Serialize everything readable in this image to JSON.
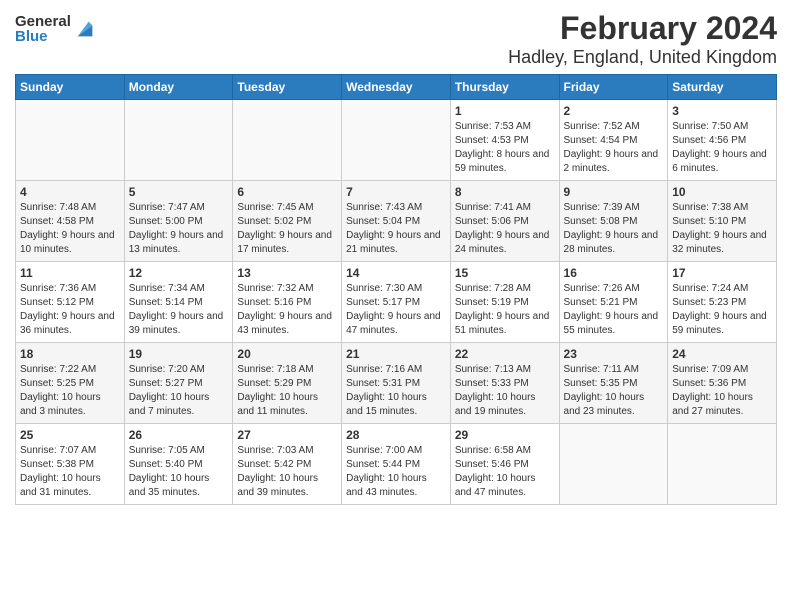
{
  "logo": {
    "general": "General",
    "blue": "Blue"
  },
  "title": "February 2024",
  "subtitle": "Hadley, England, United Kingdom",
  "headers": [
    "Sunday",
    "Monday",
    "Tuesday",
    "Wednesday",
    "Thursday",
    "Friday",
    "Saturday"
  ],
  "weeks": [
    [
      {
        "day": "",
        "info": ""
      },
      {
        "day": "",
        "info": ""
      },
      {
        "day": "",
        "info": ""
      },
      {
        "day": "",
        "info": ""
      },
      {
        "day": "1",
        "info": "Sunrise: 7:53 AM\nSunset: 4:53 PM\nDaylight: 8 hours and 59 minutes."
      },
      {
        "day": "2",
        "info": "Sunrise: 7:52 AM\nSunset: 4:54 PM\nDaylight: 9 hours and 2 minutes."
      },
      {
        "day": "3",
        "info": "Sunrise: 7:50 AM\nSunset: 4:56 PM\nDaylight: 9 hours and 6 minutes."
      }
    ],
    [
      {
        "day": "4",
        "info": "Sunrise: 7:48 AM\nSunset: 4:58 PM\nDaylight: 9 hours and 10 minutes."
      },
      {
        "day": "5",
        "info": "Sunrise: 7:47 AM\nSunset: 5:00 PM\nDaylight: 9 hours and 13 minutes."
      },
      {
        "day": "6",
        "info": "Sunrise: 7:45 AM\nSunset: 5:02 PM\nDaylight: 9 hours and 17 minutes."
      },
      {
        "day": "7",
        "info": "Sunrise: 7:43 AM\nSunset: 5:04 PM\nDaylight: 9 hours and 21 minutes."
      },
      {
        "day": "8",
        "info": "Sunrise: 7:41 AM\nSunset: 5:06 PM\nDaylight: 9 hours and 24 minutes."
      },
      {
        "day": "9",
        "info": "Sunrise: 7:39 AM\nSunset: 5:08 PM\nDaylight: 9 hours and 28 minutes."
      },
      {
        "day": "10",
        "info": "Sunrise: 7:38 AM\nSunset: 5:10 PM\nDaylight: 9 hours and 32 minutes."
      }
    ],
    [
      {
        "day": "11",
        "info": "Sunrise: 7:36 AM\nSunset: 5:12 PM\nDaylight: 9 hours and 36 minutes."
      },
      {
        "day": "12",
        "info": "Sunrise: 7:34 AM\nSunset: 5:14 PM\nDaylight: 9 hours and 39 minutes."
      },
      {
        "day": "13",
        "info": "Sunrise: 7:32 AM\nSunset: 5:16 PM\nDaylight: 9 hours and 43 minutes."
      },
      {
        "day": "14",
        "info": "Sunrise: 7:30 AM\nSunset: 5:17 PM\nDaylight: 9 hours and 47 minutes."
      },
      {
        "day": "15",
        "info": "Sunrise: 7:28 AM\nSunset: 5:19 PM\nDaylight: 9 hours and 51 minutes."
      },
      {
        "day": "16",
        "info": "Sunrise: 7:26 AM\nSunset: 5:21 PM\nDaylight: 9 hours and 55 minutes."
      },
      {
        "day": "17",
        "info": "Sunrise: 7:24 AM\nSunset: 5:23 PM\nDaylight: 9 hours and 59 minutes."
      }
    ],
    [
      {
        "day": "18",
        "info": "Sunrise: 7:22 AM\nSunset: 5:25 PM\nDaylight: 10 hours and 3 minutes."
      },
      {
        "day": "19",
        "info": "Sunrise: 7:20 AM\nSunset: 5:27 PM\nDaylight: 10 hours and 7 minutes."
      },
      {
        "day": "20",
        "info": "Sunrise: 7:18 AM\nSunset: 5:29 PM\nDaylight: 10 hours and 11 minutes."
      },
      {
        "day": "21",
        "info": "Sunrise: 7:16 AM\nSunset: 5:31 PM\nDaylight: 10 hours and 15 minutes."
      },
      {
        "day": "22",
        "info": "Sunrise: 7:13 AM\nSunset: 5:33 PM\nDaylight: 10 hours and 19 minutes."
      },
      {
        "day": "23",
        "info": "Sunrise: 7:11 AM\nSunset: 5:35 PM\nDaylight: 10 hours and 23 minutes."
      },
      {
        "day": "24",
        "info": "Sunrise: 7:09 AM\nSunset: 5:36 PM\nDaylight: 10 hours and 27 minutes."
      }
    ],
    [
      {
        "day": "25",
        "info": "Sunrise: 7:07 AM\nSunset: 5:38 PM\nDaylight: 10 hours and 31 minutes."
      },
      {
        "day": "26",
        "info": "Sunrise: 7:05 AM\nSunset: 5:40 PM\nDaylight: 10 hours and 35 minutes."
      },
      {
        "day": "27",
        "info": "Sunrise: 7:03 AM\nSunset: 5:42 PM\nDaylight: 10 hours and 39 minutes."
      },
      {
        "day": "28",
        "info": "Sunrise: 7:00 AM\nSunset: 5:44 PM\nDaylight: 10 hours and 43 minutes."
      },
      {
        "day": "29",
        "info": "Sunrise: 6:58 AM\nSunset: 5:46 PM\nDaylight: 10 hours and 47 minutes."
      },
      {
        "day": "",
        "info": ""
      },
      {
        "day": "",
        "info": ""
      }
    ]
  ]
}
